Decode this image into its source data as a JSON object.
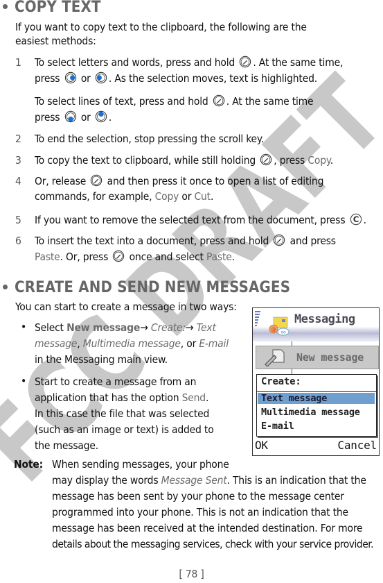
{
  "section1": {
    "heading": "COPY TEXT",
    "intro_line1": "If you want to copy text to the clipboard, the following are the",
    "intro_line2": "easiest methods:",
    "steps": [
      {
        "number": "1",
        "line1_a": "To select letters and words, press and hold",
        "line1_b": ". At the same time,",
        "line2_a": "press",
        "line2_or": "or",
        "line2_b": ". As the selection moves, text is highlighted.",
        "sub_line1_a": "To select lines of text, press and hold",
        "sub_line1_b": ". At the same time",
        "sub_line2_a": "press",
        "sub_line2_or": "or",
        "sub_line2_b": "."
      },
      {
        "number": "2",
        "text": "To end the selection, stop pressing the scroll key."
      },
      {
        "number": "3",
        "text_a": "To copy the text to clipboard, while still holding",
        "text_b": ", press",
        "cmd": "Copy",
        "text_c": "."
      },
      {
        "number": "4",
        "line1_a": "Or, release",
        "line1_b": "and then press it once to open a list of editing",
        "line2_a": "commands, for example,",
        "cmd1": "Copy",
        "or": "or",
        "cmd2": "Cut",
        "line2_b": "."
      },
      {
        "number": "5",
        "text_a": "If you want to remove the selected text from the document, press",
        "text_b": "."
      },
      {
        "number": "6",
        "line1_a": "To insert the text into a document, press and hold",
        "line1_b": "and press",
        "cmd1": "Paste",
        "line2_a": ". Or, press",
        "line2_b": "once and select",
        "cmd2": "Paste",
        "line2_c": "."
      }
    ]
  },
  "section2": {
    "heading": "CREATE AND SEND NEW MESSAGES",
    "intro": "You can start to create a message in two ways:",
    "bullet1": {
      "select": "Select",
      "cmd": "New message",
      "arrow1": "→",
      "create": "Create:",
      "arrow2": "→",
      "text_msg": "Text",
      "text_msg2": "message",
      "comma1": ",",
      "mms": "Multimedia message",
      "comma_or": ", or",
      "email": "E-mail",
      "line3": "in the Messaging main view."
    },
    "bullet2": {
      "line1": "Start to create a message from an",
      "line2_a": "application that has the option",
      "cmd": "Send",
      "line2_b": ".",
      "line3": "In this case the file that was selected",
      "line4": "(such as an image or text) is added to",
      "line5": "the message."
    },
    "note": {
      "label": "Note:",
      "line1": "When sending messages, your phone",
      "line2_a": "may display the words",
      "line2_it": "Message Sent",
      "line2_b": ". This is an indication that the",
      "line3": "message has been sent by your phone to the message center",
      "line4": "programmed into your phone. This is not an indication that the",
      "line5": "message has been received at the intended destination. For more",
      "line6": "details about the messaging services, check with your service provider."
    }
  },
  "phone_screen": {
    "title": "Messaging",
    "new_message": "New message",
    "menu_title": "Create:",
    "menu_items": [
      "Text message",
      "Multimedia message",
      "E-mail"
    ],
    "selected_index": 0,
    "left_softkey": "OK",
    "right_softkey": "Cancel",
    "highlight_color": "#6f9fcf"
  },
  "watermark": "FCC DRAFT",
  "page_number": "[ 78 ]",
  "colors": {
    "command_text": "#6b6b6b",
    "heading": "#666666",
    "key_blue": "#1a6fd0",
    "watermark": "#c8c8c8"
  }
}
